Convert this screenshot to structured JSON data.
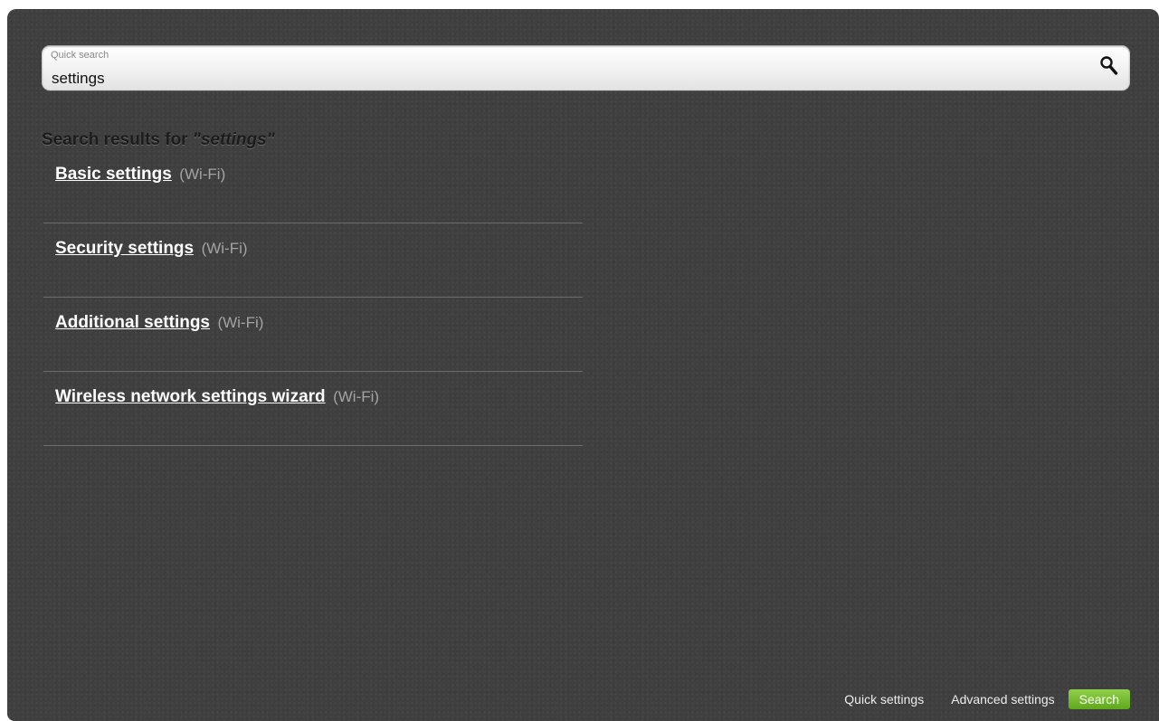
{
  "search": {
    "label": "Quick search",
    "value": "settings",
    "icon": "search-icon"
  },
  "results": {
    "title_prefix": "Search results for ",
    "title_query": "\"settings\"",
    "items": [
      {
        "label": "Basic settings",
        "category": "(Wi-Fi)"
      },
      {
        "label": "Security settings",
        "category": "(Wi-Fi)"
      },
      {
        "label": "Additional settings",
        "category": "(Wi-Fi)"
      },
      {
        "label": "Wireless network settings wizard",
        "category": "(Wi-Fi)"
      }
    ]
  },
  "footer": {
    "quick_settings": "Quick settings",
    "advanced_settings": "Advanced settings",
    "search": "Search"
  },
  "colors": {
    "panel_background": "#3f3f3f",
    "active_button": "#6fb82a",
    "result_link": "#ffffff",
    "result_category": "#a3a3a3"
  }
}
